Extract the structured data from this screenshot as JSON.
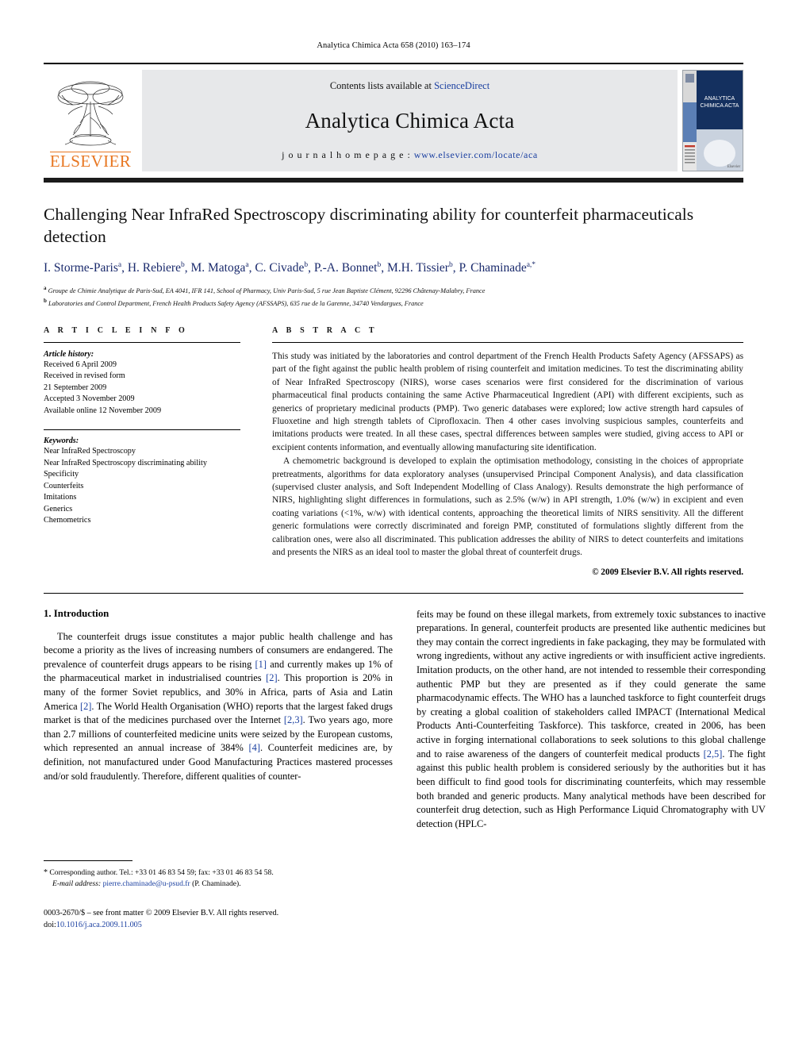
{
  "running_head": "Analytica Chimica Acta 658 (2010) 163–174",
  "masthead": {
    "contents_prefix": "Contents lists available at ",
    "contents_link": "ScienceDirect",
    "journal_title": "Analytica Chimica Acta",
    "homepage_label": "j o u r n a l   h o m e p a g e :",
    "homepage_url": "www.elsevier.com/locate/aca",
    "publisher": "ELSEVIER",
    "cover_title_line1": "ANALYTICA",
    "cover_title_line2": "CHIMICA ACTA"
  },
  "article": {
    "title": "Challenging Near InfraRed Spectroscopy discriminating ability for counterfeit pharmaceuticals detection",
    "authors": [
      {
        "name": "I. Storme-Paris",
        "sup": "a"
      },
      {
        "name": "H. Rebiere",
        "sup": "b"
      },
      {
        "name": "M. Matoga",
        "sup": "a"
      },
      {
        "name": "C. Civade",
        "sup": "b"
      },
      {
        "name": "P.-A. Bonnet",
        "sup": "b"
      },
      {
        "name": "M.H. Tissier",
        "sup": "b"
      },
      {
        "name": "P. Chaminade",
        "sup": "a,*"
      }
    ],
    "affiliations": [
      {
        "label": "a",
        "text": "Groupe de Chimie Analytique de Paris-Sud, EA 4041, IFR 141, School of Pharmacy, Univ Paris-Sud, 5 rue Jean Baptiste Clément, 92296 Châtenay-Malabry, France"
      },
      {
        "label": "b",
        "text": "Laboratories and Control Department, French Health Products Safety Agency (AFSSAPS), 635 rue de la Garenne, 34740 Vendargues, France"
      }
    ]
  },
  "article_info": {
    "heading": "A R T I C L E   I N F O",
    "history_label": "Article history:",
    "history": [
      "Received 6 April 2009",
      "Received in revised form",
      "21 September 2009",
      "Accepted 3 November 2009",
      "Available online 12 November 2009"
    ],
    "keywords_label": "Keywords:",
    "keywords": [
      "Near InfraRed Spectroscopy",
      "Near InfraRed Spectroscopy discriminating ability",
      "Specificity",
      "Counterfeits",
      "Imitations",
      "Generics",
      "Chemometrics"
    ]
  },
  "abstract": {
    "heading": "A B S T R A C T",
    "paragraph1": "This study was initiated by the laboratories and control department of the French Health Products Safety Agency (AFSSAPS) as part of the fight against the public health problem of rising counterfeit and imitation medicines. To test the discriminating ability of Near InfraRed Spectroscopy (NIRS), worse cases scenarios were first considered for the discrimination of various pharmaceutical final products containing the same Active Pharmaceutical Ingredient (API) with different excipients, such as generics of proprietary medicinal products (PMP). Two generic databases were explored; low active strength hard capsules of Fluoxetine and high strength tablets of Ciprofloxacin. Then 4 other cases involving suspicious samples, counterfeits and imitations products were treated. In all these cases, spectral differences between samples were studied, giving access to API or excipient contents information, and eventually allowing manufacturing site identification.",
    "paragraph2": "A chemometric background is developed to explain the optimisation methodology, consisting in the choices of appropriate pretreatments, algorithms for data exploratory analyses (unsupervised Principal Component Analysis), and data classification (supervised cluster analysis, and Soft Independent Modelling of Class Analogy). Results demonstrate the high performance of NIRS, highlighting slight differences in formulations, such as 2.5% (w/w) in API strength, 1.0% (w/w) in excipient and even coating variations (<1%, w/w) with identical contents, approaching the theoretical limits of NIRS sensitivity. All the different generic formulations were correctly discriminated and foreign PMP, constituted of formulations slightly different from the calibration ones, were also all discriminated. This publication addresses the ability of NIRS to detect counterfeits and imitations and presents the NIRS as an ideal tool to master the global threat of counterfeit drugs.",
    "copyright": "© 2009 Elsevier B.V. All rights reserved."
  },
  "introduction": {
    "section_number_title": "1.  Introduction",
    "left_column_html": "The counterfeit drugs issue constitutes a major public health challenge and has become a priority as the lives of increasing numbers of consumers are endangered. The prevalence of counterfeit drugs appears to be rising <span class=\"ref\">[1]</span> and currently makes up 1% of the pharmaceutical market in industrialised countries <span class=\"ref\">[2]</span>. This proportion is 20% in many of the former Soviet republics, and 30% in Africa, parts of Asia and Latin America <span class=\"ref\">[2]</span>. The World Health Organisation (WHO) reports that the largest faked drugs market is that of the medicines purchased over the Internet <span class=\"ref\">[2,3]</span>. Two years ago, more than 2.7 millions of counterfeited medicine units were seized by the European customs, which represented an annual increase of 384% <span class=\"ref\">[4]</span>. Counterfeit medicines are, by definition, not manufactured under Good Manufacturing Practices mastered processes and/or sold fraudulently. Therefore, different qualities of counter-",
    "right_column_html": "feits may be found on these illegal markets, from extremely toxic substances to inactive preparations. In general, counterfeit products are presented like authentic medicines but they may contain the correct ingredients in fake packaging, they may be formulated with wrong ingredients, without any active ingredients or with insufficient active ingredients. Imitation products, on the other hand, are not intended to ressemble their corresponding authentic PMP but they are presented as if they could generate the same pharmacodynamic effects. The WHO has a launched taskforce to fight counterfeit drugs by creating a global coalition of stakeholders called IMPACT (International Medical Products Anti-Counterfeiting Taskforce). This taskforce, created in 2006, has been active in forging international collaborations to seek solutions to this global challenge and to raise awareness of the dangers of counterfeit medical products <span class=\"ref\">[2,5]</span>. The fight against this public health problem is considered seriously by the authorities but it has been difficult to find good tools for discriminating counterfeits, which may ressemble both branded and generic products. Many analytical methods have been described for counterfeit drug detection, such as High Performance Liquid Chromatography with UV detection (HPLC-"
  },
  "footnote": {
    "star": "*",
    "corresponding": "Corresponding author. Tel.: +33 01 46 83 54 59; fax: +33 01 46 83 54 58.",
    "email_label": "E-mail address:",
    "email": "pierre.chaminade@u-psud.fr",
    "email_suffix": "(P. Chaminade)."
  },
  "footer": {
    "issn_line": "0003-2670/$ – see front matter © 2009 Elsevier B.V. All rights reserved.",
    "doi_label": "doi:",
    "doi": "10.1016/j.aca.2009.11.005"
  },
  "colors": {
    "link_blue": "#1a3fa0",
    "author_blue": "#1a2a6c",
    "elsevier_orange": "#E87722",
    "band_grey": "#e7e8ea",
    "cover_navy": "#1b2f6b"
  }
}
